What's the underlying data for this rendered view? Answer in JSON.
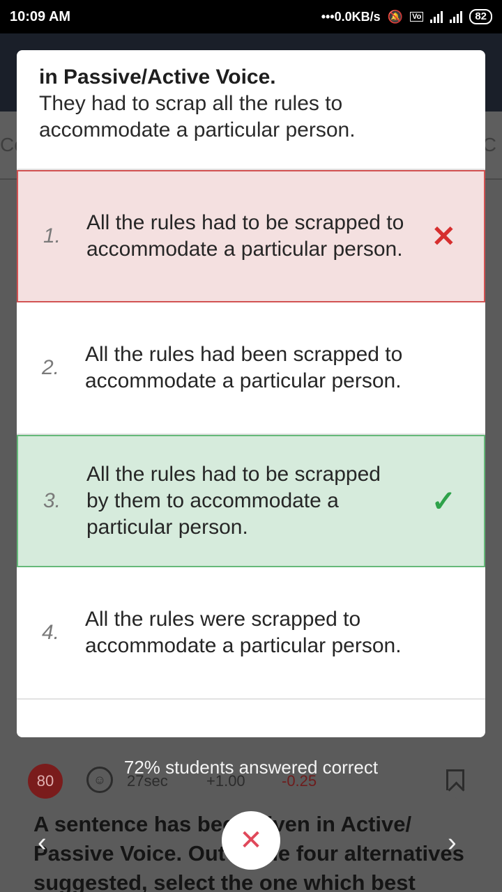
{
  "status_bar": {
    "time": "10:09 AM",
    "network_speed": "•••0.0KB/s",
    "battery": "82",
    "icons": [
      "mute-bell-icon",
      "volte-icon",
      "signal-4g-icon",
      "signal-icon",
      "battery-icon"
    ]
  },
  "background": {
    "tab_left_fragment": "Co",
    "tab_right_fragment": "d C",
    "question_number": "80",
    "timer": "27sec",
    "positive_marks": "+1.00",
    "negative_marks": "-0.25",
    "question_text": "A sentence has been given in Active/ Passive Voice. Out of the four  alternatives suggested, select the one which best",
    "colors": {
      "negative": "#6e1c1c"
    }
  },
  "dialog": {
    "title": "in Passive/Active Voice.",
    "sentence": "They had to scrap all the rules to accommodate a particular person.",
    "options": [
      {
        "number": "1.",
        "text": "All the rules had to be scrapped to accommodate a particular person.",
        "state": "wrong",
        "mark_icon": "cross-icon"
      },
      {
        "number": "2.",
        "text": "All the rules had been scrapped to accommodate a particular person.",
        "state": "neutral"
      },
      {
        "number": "3.",
        "text": "All the rules had to be scrapped by them to accommodate a particular person.",
        "state": "correct",
        "mark_icon": "check-icon"
      },
      {
        "number": "4.",
        "text": "All the rules were scrapped to accommodate a particular person.",
        "state": "neutral"
      }
    ],
    "colors": {
      "wrong_bg": "#f4e0e0",
      "wrong_border": "#d25252",
      "correct_bg": "#d6ebdc",
      "correct_border": "#65b979"
    }
  },
  "footer": {
    "students_text": "72% students answered correct",
    "close_icon": "close-icon",
    "prev_icon": "chevron-left-icon",
    "next_icon": "chevron-right-icon"
  }
}
